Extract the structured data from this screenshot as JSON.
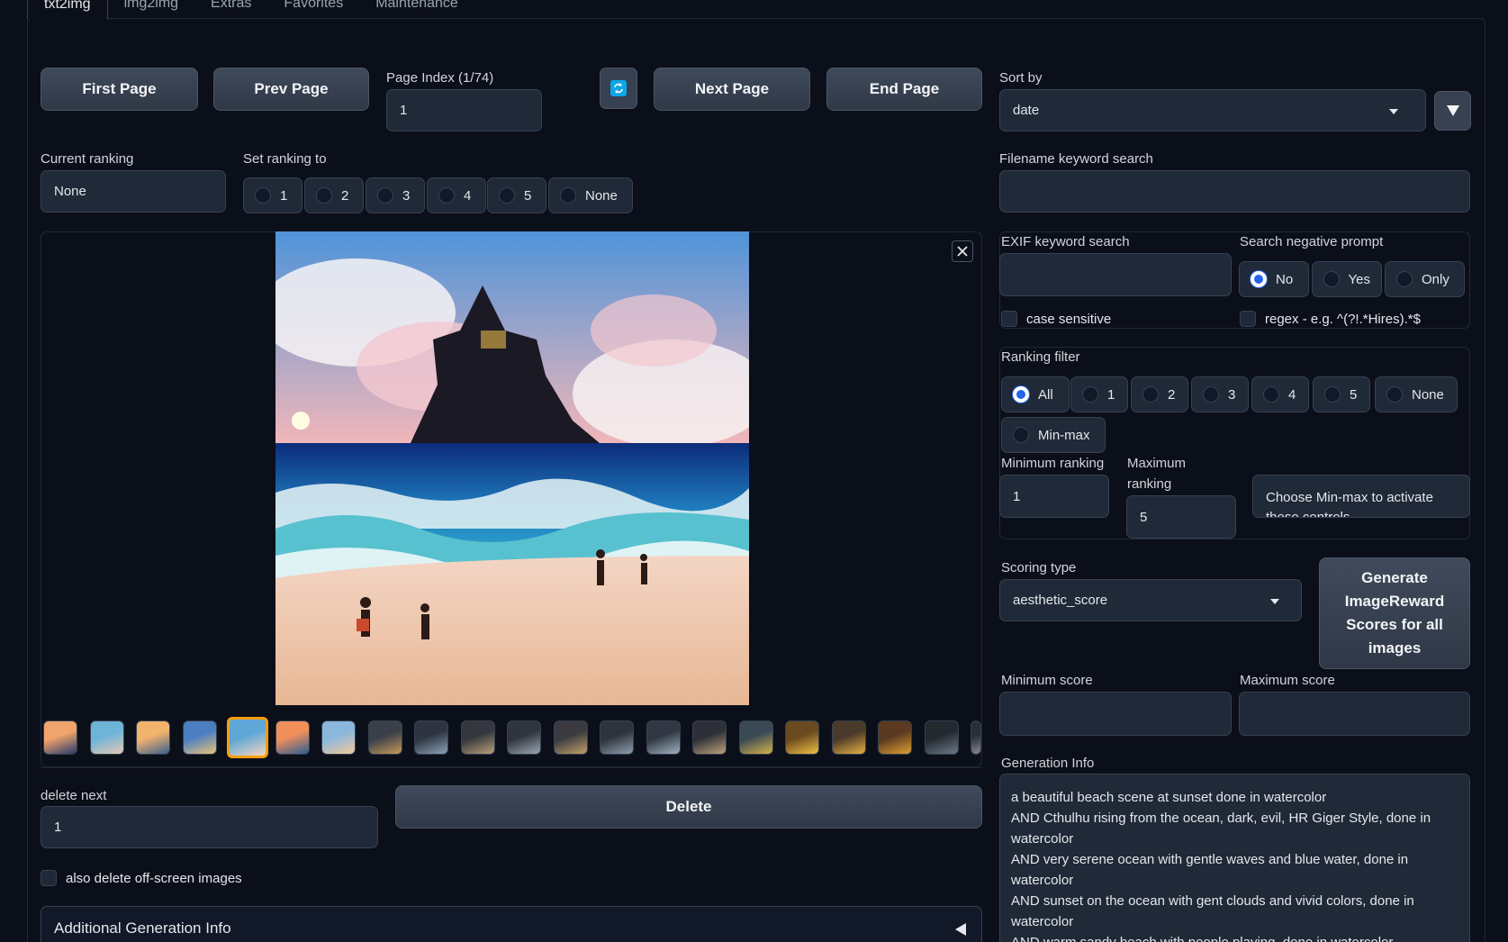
{
  "tabs": [
    "txt2img",
    "img2img",
    "Extras",
    "Favorites",
    "Maintenance"
  ],
  "nav": {
    "first": "First Page",
    "prev": "Prev Page",
    "next": "Next Page",
    "end": "End Page",
    "page_index_label": "Page Index (1/74)",
    "page_index_value": "1"
  },
  "sort": {
    "label": "Sort by",
    "value": "date"
  },
  "ranking": {
    "current_label": "Current ranking",
    "current_value": "None",
    "set_label": "Set ranking to",
    "options": [
      "1",
      "2",
      "3",
      "4",
      "5",
      "None"
    ]
  },
  "filename_search": {
    "label": "Filename keyword search",
    "value": ""
  },
  "exif": {
    "label": "EXIF keyword search",
    "value": "",
    "neg_label": "Search negative prompt",
    "neg_options": [
      "No",
      "Yes",
      "Only"
    ],
    "neg_selected": "No",
    "case_sensitive": "case sensitive",
    "regex": "regex - e.g. ^(?!.*Hires).*$"
  },
  "ranking_filter": {
    "label": "Ranking filter",
    "options": [
      "All",
      "1",
      "2",
      "3",
      "4",
      "5",
      "None",
      "Min-max"
    ],
    "selected": "All",
    "min_label": "Minimum ranking",
    "min_value": "1",
    "max_label_1": "Maximum",
    "max_label_2": "ranking",
    "max_value": "5",
    "hint": "Choose Min-max to activate these controls"
  },
  "scoring": {
    "label": "Scoring type",
    "value": "aesthetic_score",
    "generate_button": "Generate ImageReward Scores for all images",
    "min_label": "Minimum score",
    "max_label": "Maximum score"
  },
  "delete": {
    "label": "delete next",
    "value": "1",
    "button": "Delete",
    "offscreen": "also delete off-screen images"
  },
  "additional_info": "Additional Generation Info",
  "generation_info": {
    "label": "Generation Info",
    "lines": [
      "a beautiful beach scene at sunset done in watercolor",
      "AND Cthulhu rising from the ocean, dark, evil, HR Giger Style, done in",
      "watercolor",
      "AND very serene ocean with gentle waves and blue water, done in",
      "watercolor",
      "AND sunset on the ocean with gent clouds and vivid colors, done in",
      "watercolor",
      "AND warm sandy beach with people playing, done in watercolor"
    ]
  },
  "icons": {
    "refresh": "refresh-icon",
    "close": "close-icon",
    "sort_dir": "triangle-down-icon",
    "collapse": "triangle-left-icon"
  },
  "colors": {
    "accent": "#2563eb",
    "selected_thumb": "#f59e0b"
  }
}
